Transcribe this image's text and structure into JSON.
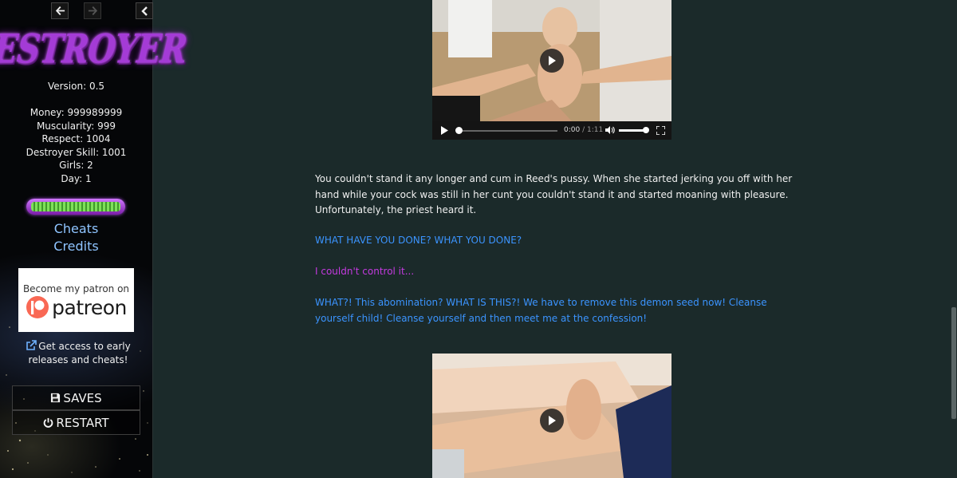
{
  "sidebar": {
    "nav": {
      "back_glyph": "🡐",
      "forward_glyph": "🡒",
      "collapse_glyph": "❮"
    },
    "logo_text": "DESTROYER",
    "version": "Version: 0.5",
    "stats": [
      "Money: 999989999",
      "Muscularity: 999",
      "Respect: 1004",
      "Destroyer Skill: 1001",
      "Girls: 2",
      "Day: 1"
    ],
    "energy_level": 1.0,
    "links": {
      "cheats": "Cheats",
      "credits": "Credits"
    },
    "patreon": {
      "tagline": "Become my patron on",
      "brand": "patreon",
      "brand_color": "#f96854"
    },
    "early_access": "Get access to early releases and cheats!",
    "menu": {
      "saves": "SAVES",
      "restart": "RESTART"
    }
  },
  "main": {
    "video_1": {
      "time_current": "0:00",
      "time_separator": "/",
      "time_duration": "1:11"
    },
    "narration": "You couldn't stand it any longer and cum in Reed's pussy. When she started jerking you off with her hand while your cock was still in her cunt you couldn't stand it and started moaning with pleasure. Unfortunately, the priest heard it.",
    "priest_line_1": "WHAT HAVE YOU DONE? WHAT YOU DONE?",
    "player_line": "I couldn't control it...",
    "priest_line_2": "WHAT?! This abomination? WHAT IS THIS?! We have to remove this demon seed now! Cleanse yourself child! Cleanse yourself and then meet me at the confession!"
  },
  "colors": {
    "background": "#1b2a2a",
    "priest_text": "#3b94ff",
    "player_text": "#c43ae0",
    "link": "#8fc4ff",
    "logo_purple": "#a43bd6"
  },
  "icons": {
    "back": "arrow-left-icon",
    "forward": "arrow-right-icon",
    "collapse": "chevron-left-icon",
    "external": "external-link-icon",
    "saves": "floppy-disk-icon",
    "restart": "power-icon",
    "play": "play-icon",
    "volume": "volume-icon",
    "fullscreen": "fullscreen-icon"
  }
}
